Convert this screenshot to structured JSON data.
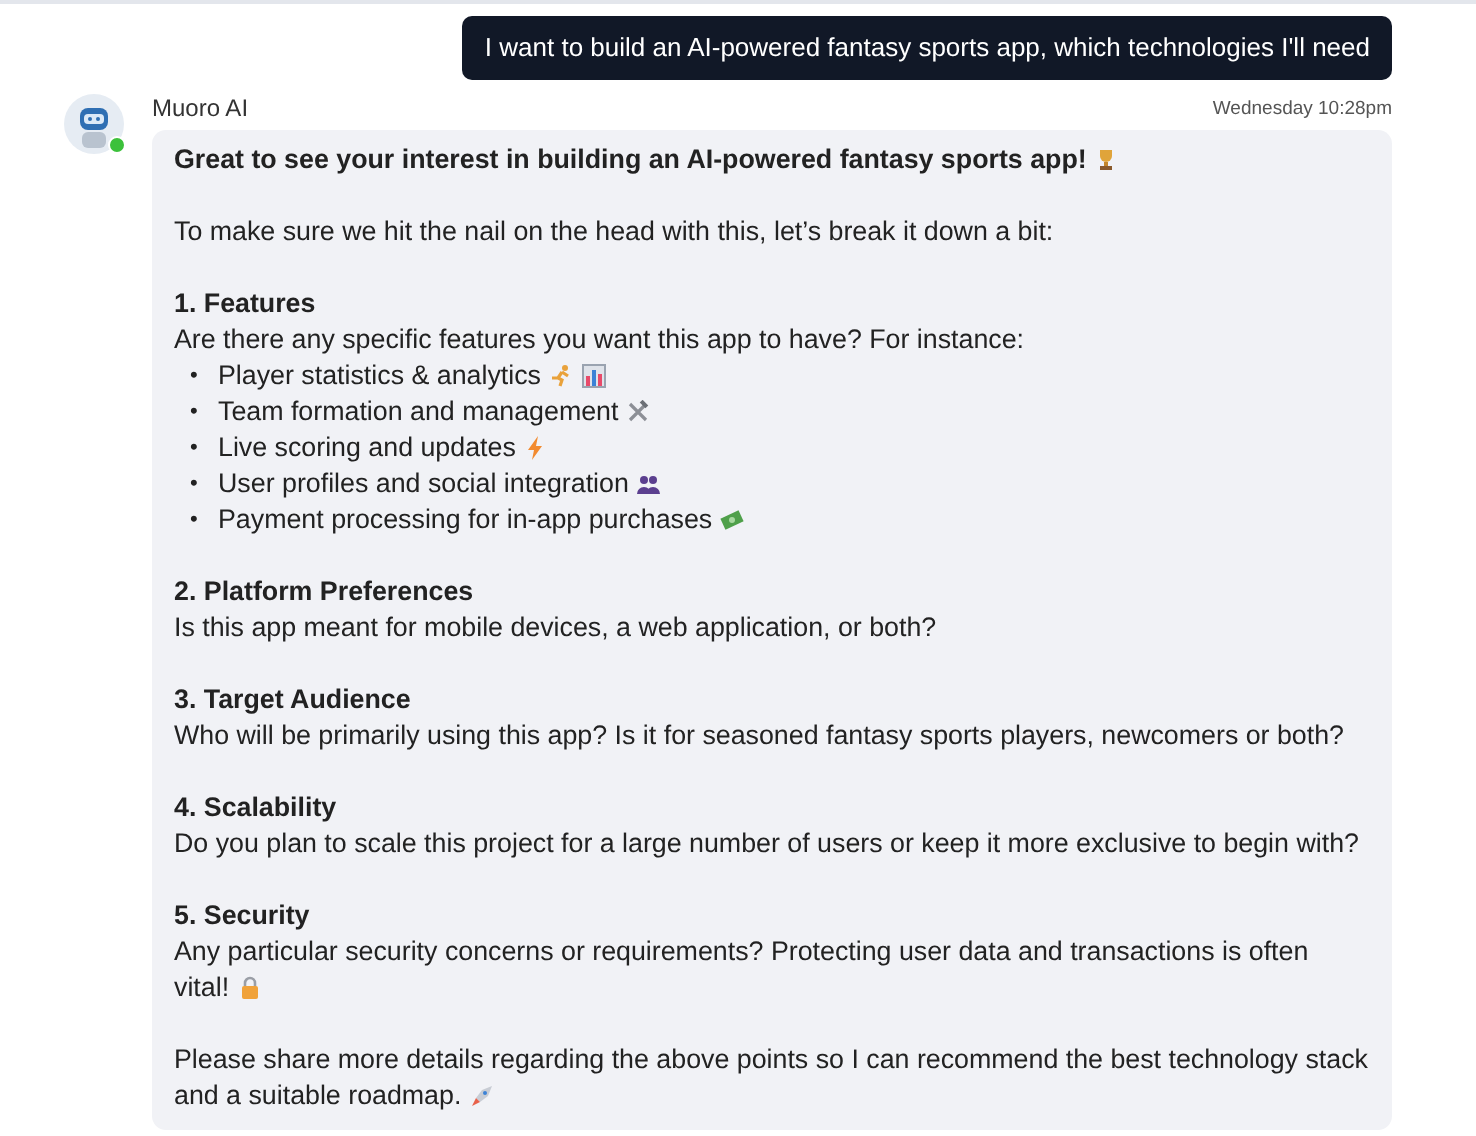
{
  "user_message": {
    "text": "I want to build an AI-powered fantasy sports app, which technologies I'll need"
  },
  "reply": {
    "sender": "Muoro AI",
    "online": true,
    "time": "Wednesday 10:28pm",
    "blocks": [
      {
        "kind": "lead",
        "text": "Great to see your interest in building an AI-powered fantasy sports app!",
        "icons": [
          {
            "kind": "trophy"
          }
        ]
      },
      {
        "kind": "paragraph",
        "text": "To make sure we hit the nail on the head with this, let’s break it down a bit:"
      },
      {
        "kind": "section",
        "title": "1. Features",
        "text": "Are there any specific features you want this app to have? For instance:",
        "items": [
          {
            "marker": "•",
            "text": "Player statistics & analytics",
            "icons": [
              {
                "kind": "runner"
              },
              {
                "kind": "chart"
              }
            ]
          },
          {
            "marker": "•",
            "text": "Team formation and management",
            "icons": [
              {
                "kind": "tools"
              }
            ]
          },
          {
            "marker": "•",
            "text": "Live scoring and updates",
            "icons": [
              {
                "kind": "bolt"
              }
            ]
          },
          {
            "marker": "•",
            "text": "User profiles and social integration",
            "icons": [
              {
                "kind": "people"
              }
            ]
          },
          {
            "marker": "•",
            "text": "Payment processing for in-app purchases",
            "icons": [
              {
                "kind": "money"
              }
            ]
          }
        ]
      },
      {
        "kind": "section",
        "title": "2. Platform Preferences",
        "text": "Is this app meant for mobile devices, a web application, or both?"
      },
      {
        "kind": "section",
        "title": "3. Target Audience",
        "text": "Who will be primarily using this app? Is it for seasoned fantasy sports players, newcomers or both?"
      },
      {
        "kind": "section",
        "title": "4. Scalability",
        "text": "Do you plan to scale this project for a large number of users or keep it more exclusive to begin with?"
      },
      {
        "kind": "section",
        "title": "5. Security",
        "text": "Any particular security concerns or requirements? Protecting user data and transactions is often vital!",
        "icons": [
          {
            "kind": "lock"
          }
        ]
      },
      {
        "kind": "paragraph",
        "text": "Please share more details regarding the above points so I can recommend the best technology stack and a suitable roadmap.",
        "icons": [
          {
            "kind": "rocket"
          }
        ]
      }
    ]
  }
}
